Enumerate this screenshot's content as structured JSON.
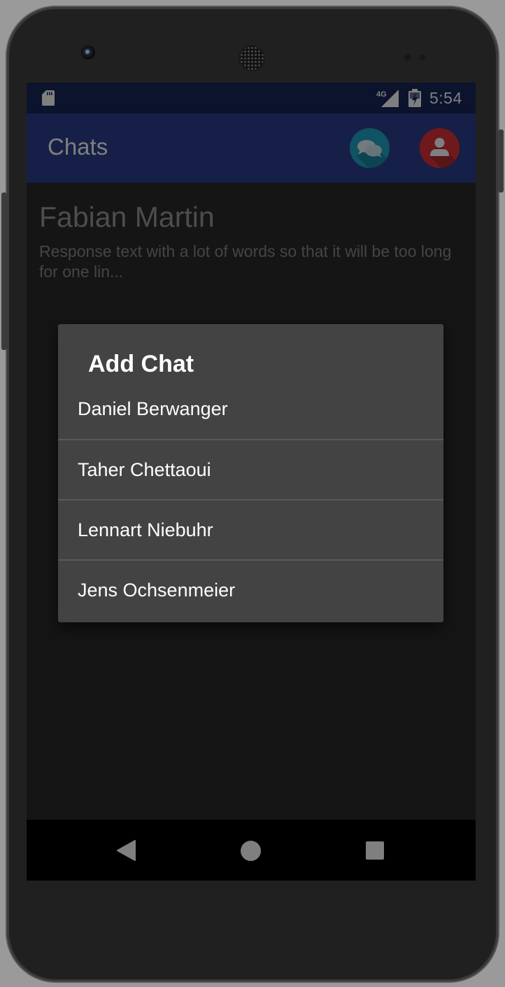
{
  "status_bar": {
    "network_label": "4G",
    "time": "5:54",
    "icons": [
      "sd-card-icon",
      "signal-icon",
      "battery-charging-icon"
    ]
  },
  "app_bar": {
    "title": "Chats",
    "actions": [
      {
        "name": "new-chat-button",
        "icon": "chat-bubbles-icon",
        "color": "#1ea6c8"
      },
      {
        "name": "profile-button",
        "icon": "person-icon",
        "color": "#e0333b"
      }
    ],
    "color": "#2c3e8e"
  },
  "chat_list": [
    {
      "name": "Fabian Martin",
      "preview": "Response text with a lot of words so that it will be too long for one lin..."
    }
  ],
  "dialog": {
    "title": "Add Chat",
    "items": [
      "Daniel Berwanger",
      "Taher Chettaoui",
      "Lennart Niebuhr",
      "Jens Ochsenmeier"
    ]
  },
  "nav_bar": {
    "buttons": [
      "back-icon",
      "home-icon",
      "recents-icon"
    ]
  }
}
